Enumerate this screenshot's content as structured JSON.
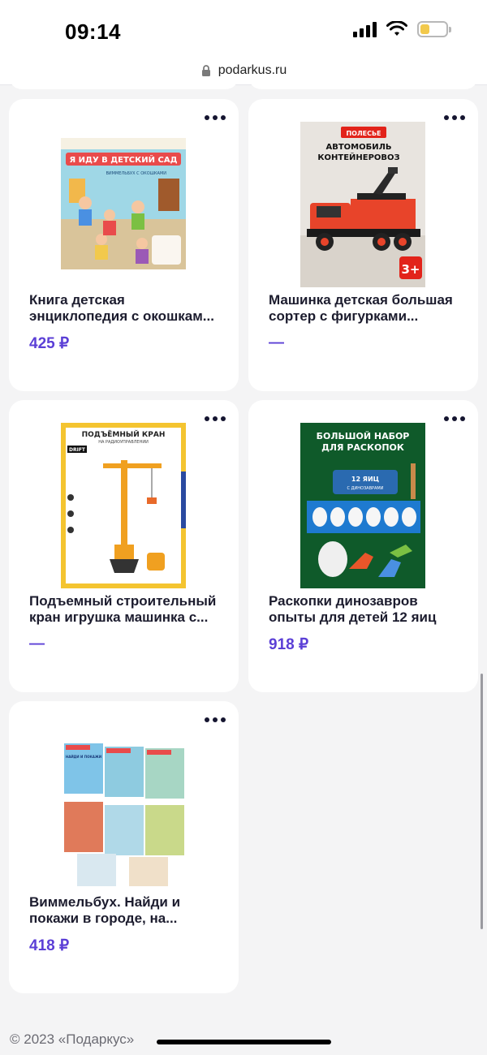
{
  "status_bar": {
    "time": "09:14"
  },
  "browser": {
    "url": "podarkus.ru"
  },
  "products": [
    {
      "title": "Книга детская энциклопедия с окошкам...",
      "price": "425 ₽",
      "image": "book-kindergarten-cover"
    },
    {
      "title": "Машинка детская большая сортер с фигурками...",
      "price": "—",
      "image": "toy-truck-container"
    },
    {
      "title": "Подъемный строительный кран игрушка машинка с...",
      "price": "—",
      "image": "toy-crane-box"
    },
    {
      "title": "Раскопки динозавров опыты для детей 12 яиц",
      "price": "918 ₽",
      "image": "dino-excavation-kit"
    },
    {
      "title": "Виммельбух. Найди и покажи в городе, на...",
      "price": "418 ₽",
      "image": "wimmelbook-set"
    }
  ],
  "footer": {
    "copyright": "© 2023 «Подаркус»"
  },
  "image_texts": {
    "book": {
      "header": "Я ИДУ В ДЕТСКИЙ САД",
      "sub": "ВИММЕЛЬБУХ С ОКОШКАМИ"
    },
    "truck": {
      "brand": "ПОЛЕСЬЕ",
      "line1": "АВТОМОБИЛЬ",
      "line2": "КОНТЕЙНЕРОВОЗ",
      "age": "3+"
    },
    "crane": {
      "line1": "ПОДЪЁМНЫЙ КРАН",
      "line2": "НА РАДИОУПРАВЛЕНИИ",
      "badge": "DRIFT"
    },
    "dino": {
      "line1": "БОЛЬШОЙ НАБОР",
      "line2": "ДЛЯ РАСКОПОК",
      "eggs": "12 ЯИЦ",
      "sub": "С ДИНОЗАВРАМИ"
    },
    "wimmel": {
      "label": "НАЙДИ И ПОКАЖИ"
    }
  },
  "colors": {
    "price": "#5b3fd6",
    "card": "#ffffff",
    "background": "#f4f4f5"
  }
}
